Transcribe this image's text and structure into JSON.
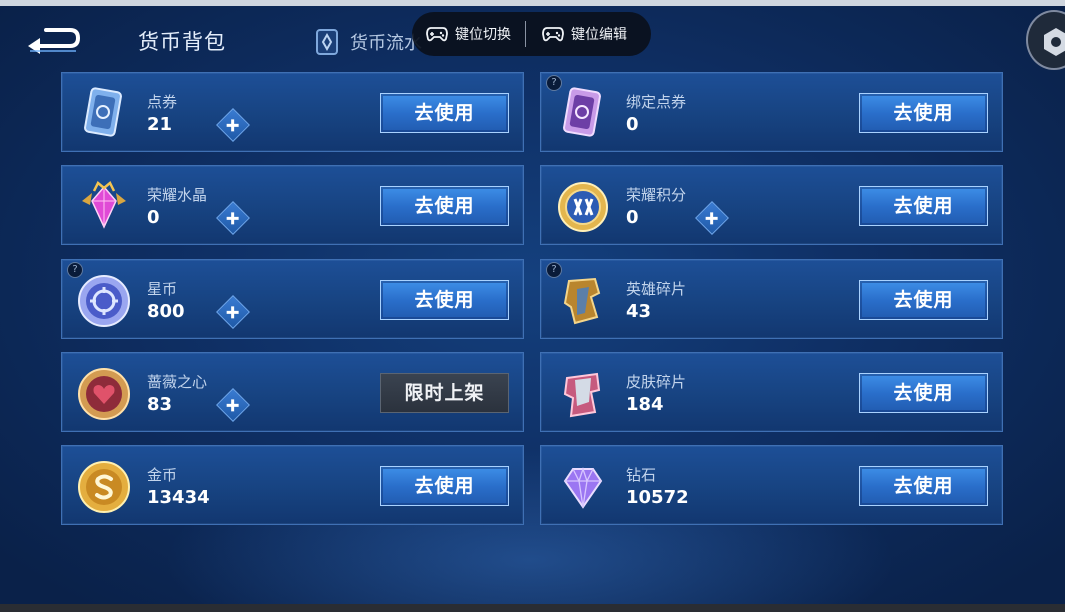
{
  "header": {
    "title": "货币背包",
    "tab_flow": "货币流水",
    "key_switch": "键位切换",
    "key_edit": "键位编辑"
  },
  "currencies": [
    {
      "name": "点券",
      "value": "21",
      "action": "去使用",
      "plus": true,
      "help": false,
      "icon": "voucher-icon"
    },
    {
      "name": "绑定点券",
      "value": "0",
      "action": "去使用",
      "plus": false,
      "help": true,
      "icon": "bound-voucher-icon"
    },
    {
      "name": "荣耀水晶",
      "value": "0",
      "action": "去使用",
      "plus": true,
      "help": false,
      "icon": "glory-crystal-icon"
    },
    {
      "name": "荣耀积分",
      "value": "0",
      "action": "去使用",
      "plus": true,
      "help": false,
      "icon": "glory-points-icon"
    },
    {
      "name": "星币",
      "value": "800",
      "action": "去使用",
      "plus": true,
      "help": true,
      "icon": "star-coin-icon"
    },
    {
      "name": "英雄碎片",
      "value": "43",
      "action": "去使用",
      "plus": false,
      "help": true,
      "icon": "hero-fragment-icon"
    },
    {
      "name": "蔷薇之心",
      "value": "83",
      "action": "限时上架",
      "plus": true,
      "help": false,
      "icon": "rose-heart-icon"
    },
    {
      "name": "皮肤碎片",
      "value": "184",
      "action": "去使用",
      "plus": false,
      "help": false,
      "icon": "skin-fragment-icon"
    },
    {
      "name": "金币",
      "value": "13434",
      "action": "去使用",
      "plus": false,
      "help": false,
      "icon": "gold-coin-icon"
    },
    {
      "name": "钻石",
      "value": "10572",
      "action": "去使用",
      "plus": false,
      "help": false,
      "icon": "diamond-icon"
    }
  ],
  "help_glyph": "?",
  "colors": {
    "background": "#0f3066",
    "card": "#174381",
    "card_border": "#3f70b4",
    "use_button": "#2a6fcb",
    "limited_button": "#2b323d"
  }
}
